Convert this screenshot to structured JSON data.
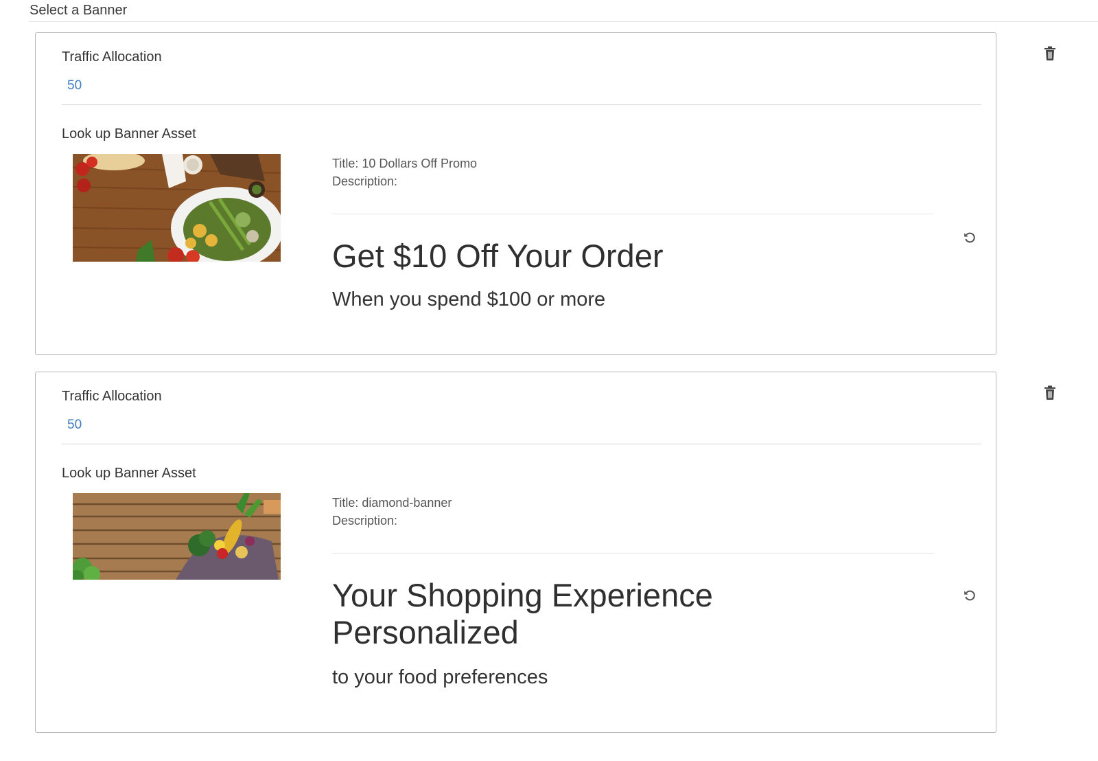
{
  "page": {
    "section_label": "Select a Banner"
  },
  "banners": [
    {
      "traffic_label": "Traffic Allocation",
      "traffic_value": "50",
      "asset_label": "Look up Banner Asset",
      "title_line": "Title: 10 Dollars Off Promo",
      "description_line": "Description:",
      "headline": "Get $10 Off Your Order",
      "subline": "When you spend $100 or more",
      "thumbnail_icon": "food-platter-image"
    },
    {
      "traffic_label": "Traffic Allocation",
      "traffic_value": "50",
      "asset_label": "Look up Banner Asset",
      "title_line": "Title: diamond-banner",
      "description_line": "Description:",
      "headline": "Your Shopping Experience Personalized",
      "subline": "to your food preferences",
      "thumbnail_icon": "vegetable-basket-image"
    }
  ],
  "icons": {
    "delete": "trash-icon",
    "reset": "restore-icon"
  },
  "colors": {
    "value_text": "#3f7cc0",
    "card_border": "#b9b9b9"
  }
}
